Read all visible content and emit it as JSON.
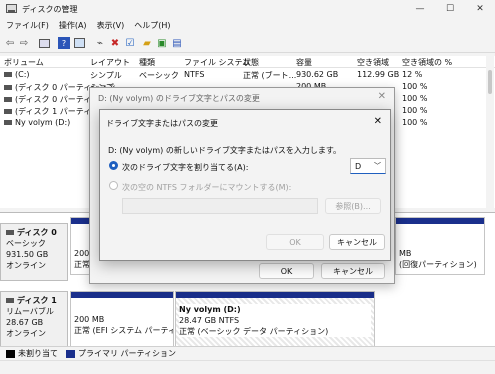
{
  "window": {
    "title": "ディスクの管理",
    "minimize": "—",
    "maximize": "☐",
    "close": "✕"
  },
  "menu": [
    "ファイル(F)",
    "操作(A)",
    "表示(V)",
    "ヘルプ(H)"
  ],
  "toolbar_icons": [
    "back-arrow-icon",
    "forward-arrow-icon",
    "console-icon",
    "help-icon",
    "properties-icon",
    "connect-icon",
    "delete-x-icon",
    "check-icon",
    "folder-up-icon",
    "new-volume-icon",
    "properties-page-icon"
  ],
  "volume_table": {
    "columns": [
      "ボリューム",
      "レイアウト",
      "種類",
      "ファイル システム",
      "状態",
      "容量",
      "空き領域",
      "空き領域の %"
    ],
    "rows": [
      [
        "(C:)",
        "シンプル",
        "ベーシック",
        "NTFS",
        "正常 (ブート...",
        "930.62 GB",
        "112.99 GB",
        "12 %"
      ],
      [
        "(ディスク 0 パーティション...",
        "シンプ...",
        "",
        "",
        "",
        "200 MB",
        "",
        "100 %"
      ],
      [
        "(ディスク 0 パーティション...",
        "シンプ...",
        "",
        "",
        "",
        "",
        "",
        "100 %"
      ],
      [
        "(ディスク 1 パーティション...",
        "シンプ...",
        "",
        "",
        "",
        "",
        "",
        "100 %"
      ],
      [
        "Ny volym (D:)",
        "シンプ...",
        "",
        "",
        "",
        "",
        "",
        "100 %"
      ]
    ]
  },
  "disks": [
    {
      "name": "ディスク 0",
      "type": "ベーシック",
      "size": "931.50 GB",
      "status": "オンライン",
      "partitions": [
        {
          "size": "200 MB",
          "status": "正常 (EF"
        },
        {
          "size": "MB",
          "status": "(回復パーティション)"
        }
      ]
    },
    {
      "name": "ディスク 1",
      "type": "リムーバブル",
      "size": "28.67 GB",
      "status": "オンライン",
      "partitions": [
        {
          "size": "200 MB",
          "status": "正常 (EFI システム パーティショ"
        },
        {
          "label": "Ny volym (D:)",
          "size": "28.47 GB NTFS",
          "status": "正常 (ベーシック データ パーティション)"
        }
      ]
    }
  ],
  "legend": [
    {
      "label": "未割り当て",
      "color": "#000000"
    },
    {
      "label": "プライマリ パーティション",
      "color": "#1a2f8c"
    }
  ],
  "outer_dialog": {
    "title": "D: (Ny volym) のドライブ文字とパスの変更",
    "ok": "OK",
    "cancel": "キャンセル"
  },
  "inner_dialog": {
    "title": "ドライブ文字またはパスの変更",
    "instruction": "D: (Ny volym) の新しいドライブ文字またはパスを入力します。",
    "option_letter": "次のドライブ文字を割り当てる(A):",
    "drive_letter": "D",
    "option_folder": "次の空の NTFS フォルダーにマウントする(M):",
    "browse": "参照(B)...",
    "ok": "OK",
    "cancel": "キャンセル"
  }
}
